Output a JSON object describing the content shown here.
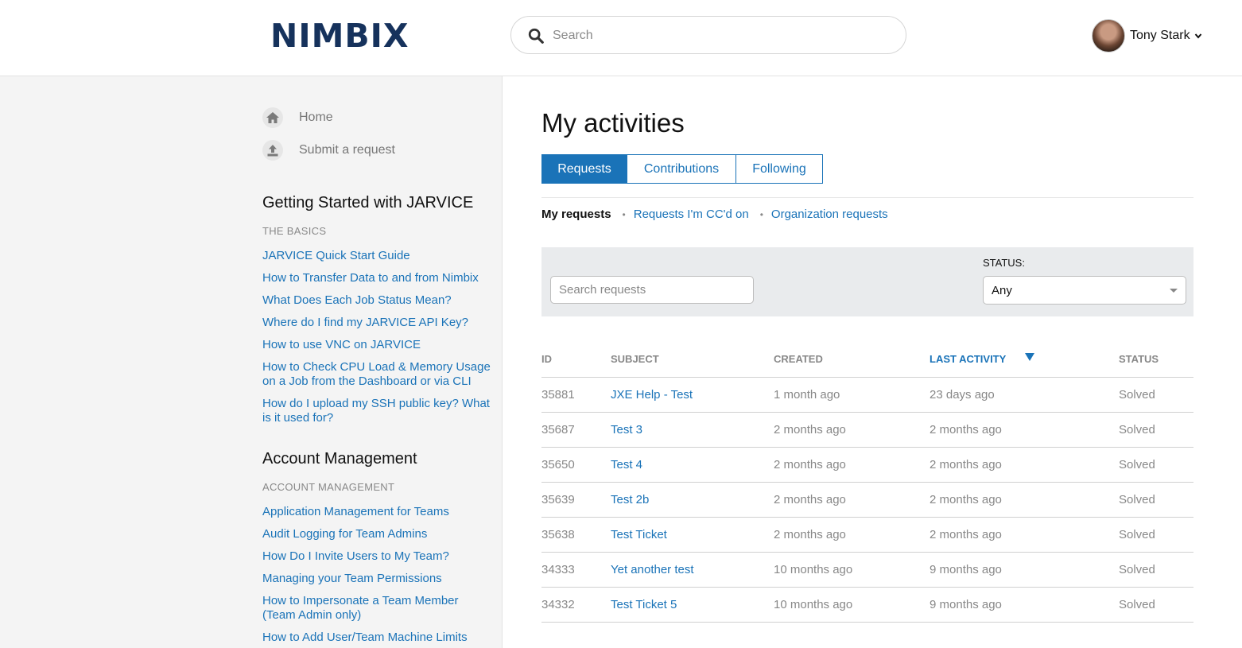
{
  "header": {
    "logo": "NIMBIX",
    "search_placeholder": "Search",
    "user_name": "Tony Stark"
  },
  "sidebar": {
    "nav": [
      {
        "label": "Home",
        "icon": "home-icon"
      },
      {
        "label": "Submit a request",
        "icon": "upload-icon"
      }
    ],
    "sections": [
      {
        "title": "Getting Started with JARVICE",
        "subtitle": "THE BASICS",
        "links": [
          "JARVICE Quick Start Guide",
          "How to Transfer Data to and from Nimbix",
          "What Does Each Job Status Mean?",
          "Where do I find my JARVICE API Key?",
          "How to use VNC on JARVICE",
          "How to Check CPU Load & Memory Usage on a Job from the Dashboard or via CLI",
          "How do I upload my SSH public key? What is it used for?"
        ]
      },
      {
        "title": "Account Management",
        "subtitle": "ACCOUNT MANAGEMENT",
        "links": [
          "Application Management for Teams",
          "Audit Logging for Team Admins",
          "How Do I Invite Users to My Team?",
          "Managing your Team Permissions",
          "How to Impersonate a Team Member (Team Admin only)",
          "How to Add User/Team Machine Limits"
        ]
      }
    ]
  },
  "main": {
    "title": "My activities",
    "tabs": [
      "Requests",
      "Contributions",
      "Following"
    ],
    "active_tab": "Requests",
    "subnav": {
      "current": "My requests",
      "links": [
        "Requests I'm CC'd on",
        "Organization requests"
      ]
    },
    "filter": {
      "search_placeholder": "Search requests",
      "status_label": "STATUS:",
      "status_value": "Any"
    },
    "table": {
      "headers": {
        "id": "ID",
        "subject": "SUBJECT",
        "created": "CREATED",
        "last_activity": "LAST ACTIVITY",
        "status": "STATUS"
      },
      "sorted_by": "last_activity",
      "sort_direction": "descending",
      "rows": [
        {
          "id": "35881",
          "subject": "JXE Help - Test",
          "created": "1 month ago",
          "last_activity": "23 days ago",
          "status": "Solved"
        },
        {
          "id": "35687",
          "subject": "Test 3",
          "created": "2 months ago",
          "last_activity": "2 months ago",
          "status": "Solved"
        },
        {
          "id": "35650",
          "subject": "Test 4",
          "created": "2 months ago",
          "last_activity": "2 months ago",
          "status": "Solved"
        },
        {
          "id": "35639",
          "subject": "Test 2b",
          "created": "2 months ago",
          "last_activity": "2 months ago",
          "status": "Solved"
        },
        {
          "id": "35638",
          "subject": "Test Ticket",
          "created": "2 months ago",
          "last_activity": "2 months ago",
          "status": "Solved"
        },
        {
          "id": "34333",
          "subject": "Yet another test",
          "created": "10 months ago",
          "last_activity": "9 months ago",
          "status": "Solved"
        },
        {
          "id": "34332",
          "subject": "Test Ticket 5",
          "created": "10 months ago",
          "last_activity": "9 months ago",
          "status": "Solved"
        }
      ]
    }
  },
  "colors": {
    "brand": "#16325c",
    "link": "#1a73b8",
    "sidebar_bg": "#f4f4f4",
    "filter_bg": "#e9ebed"
  }
}
